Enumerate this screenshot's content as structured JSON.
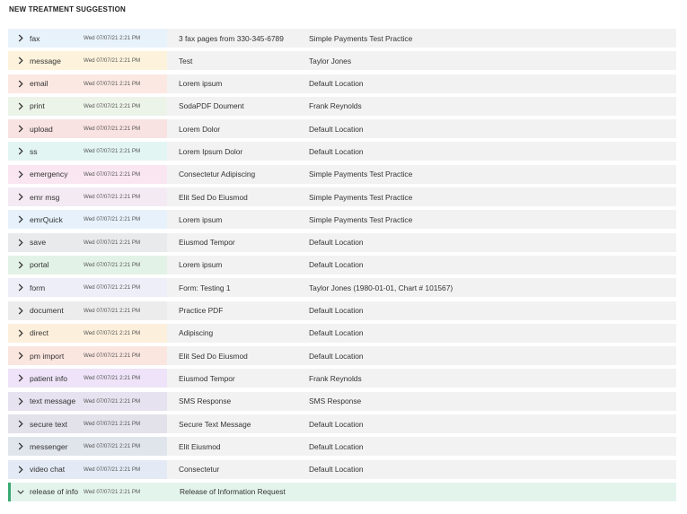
{
  "header": {
    "title": "NEW TREATMENT SUGGESTION"
  },
  "rows": [
    {
      "type": "fax",
      "date": "Wed 07/07/21 2:21 PM",
      "desc": "3 fax pages from 330-345-6789",
      "loc": "Simple Payments Test Practice",
      "color": "#3a8fd6",
      "bg": "#e8f2fb",
      "icon": "chevron-right-icon"
    },
    {
      "type": "message",
      "date": "Wed 07/07/21 2:21 PM",
      "desc": "Test",
      "loc": "Taylor Jones",
      "color": "#f0b429",
      "bg": "#fdf3dc",
      "icon": "chevron-right-icon"
    },
    {
      "type": "email",
      "date": "Wed 07/07/21 2:21 PM",
      "desc": " Lorem ipsum",
      "loc": "Default Location",
      "color": "#e06a4a",
      "bg": "#fbe8e2",
      "icon": "chevron-right-icon"
    },
    {
      "type": "print",
      "date": "Wed 07/07/21 2:21 PM",
      "desc": "SodaPDF Doument",
      "loc": "Frank Reynolds",
      "color": "#8fbc7a",
      "bg": "#ecf3e8",
      "icon": "chevron-right-icon"
    },
    {
      "type": "upload",
      "date": "Wed 07/07/21 2:21 PM",
      "desc": " Lorem Dolor",
      "loc": "Default Location",
      "color": "#d94141",
      "bg": "#f9e2e2",
      "icon": "chevron-right-icon"
    },
    {
      "type": "ss",
      "date": "Wed 07/07/21 2:21 PM",
      "desc": " Lorem Ipsum Dolor",
      "loc": "Default Location",
      "color": "#3cc4b4",
      "bg": "#e2f5f3",
      "icon": "chevron-right-icon"
    },
    {
      "type": "emergency",
      "date": "Wed 07/07/21 2:21 PM",
      "desc": " Consectetur Adipiscing",
      "loc": "Simple Payments Test Practice",
      "color": "#d6589a",
      "bg": "#f9e6f0",
      "icon": "chevron-right-icon"
    },
    {
      "type": "emr msg",
      "date": "Wed 07/07/21 2:21 PM",
      "desc": "Elit Sed Do Eiusmod",
      "loc": "Simple Payments Test Practice",
      "color": "#c78cc4",
      "bg": "#f4eaf4",
      "icon": "chevron-right-icon"
    },
    {
      "type": "emrQuick",
      "date": "Wed 07/07/21 2:21 PM",
      "desc": " Lorem ipsum",
      "loc": "Simple Payments Test Practice",
      "color": "#4a9fe0",
      "bg": "#e6f1fb",
      "icon": "chevron-right-icon"
    },
    {
      "type": "save",
      "date": "Wed 07/07/21 2:21 PM",
      "desc": "Eiusmod Tempor",
      "loc": "Default Location",
      "color": "#7a7f85",
      "bg": "#e9eaeb",
      "icon": "chevron-right-icon"
    },
    {
      "type": "portal",
      "date": "Wed 07/07/21 2:21 PM",
      "desc": " Lorem ipsum",
      "loc": "Default Location",
      "color": "#2f9a4a",
      "bg": "#e3f2e6",
      "icon": "chevron-right-icon"
    },
    {
      "type": "form",
      "date": "Wed 07/07/21 2:21 PM",
      "desc": "Form: Testing 1",
      "loc": "Taylor Jones (1980-01-01, Chart # 101567)",
      "color": "#9a9ad6",
      "bg": "#eeeef8",
      "icon": "chevron-right-icon"
    },
    {
      "type": "document",
      "date": "Wed 07/07/21 2:21 PM",
      "desc": "Practice PDF",
      "loc": "Default Location",
      "color": "#8a8a8a",
      "bg": "#ececec",
      "icon": "chevron-right-icon"
    },
    {
      "type": "direct",
      "date": "Wed 07/07/21 2:21 PM",
      "desc": "Adipiscing",
      "loc": "Default Location",
      "color": "#ef9a2a",
      "bg": "#fcefdc",
      "icon": "chevron-right-icon"
    },
    {
      "type": "pm import",
      "date": "Wed 07/07/21 2:21 PM",
      "desc": "Elit Sed Do Eiusmod",
      "loc": "Default Location",
      "color": "#e8583a",
      "bg": "#fbe5df",
      "icon": "chevron-right-icon"
    },
    {
      "type": "patient info",
      "date": "Wed 07/07/21 2:21 PM",
      "desc": "Eiusmod Tempor",
      "loc": "Frank Reynolds",
      "color": "#8a3fd0",
      "bg": "#eee3f8",
      "icon": "chevron-right-icon"
    },
    {
      "type": "text message",
      "date": "Wed 07/07/21 2:21 PM",
      "desc": "SMS Response",
      "loc": "SMS Response",
      "color": "#4a2f8a",
      "bg": "#e6e2ef",
      "icon": "chevron-right-icon"
    },
    {
      "type": "secure text",
      "date": "Wed 07/07/21 2:21 PM",
      "desc": "Secure Text Message",
      "loc": "Default Location",
      "color": "#2a1f5c",
      "bg": "#e3e1ea",
      "icon": "chevron-right-icon"
    },
    {
      "type": "messenger",
      "date": "Wed 07/07/21 2:21 PM",
      "desc": "Elit Eiusmod",
      "loc": "Default Location",
      "color": "#1f3a5c",
      "bg": "#e0e5ec",
      "icon": "chevron-right-icon"
    },
    {
      "type": "video chat",
      "date": "Wed 07/07/21 2:21 PM",
      "desc": "Consectetur",
      "loc": "Default Location",
      "color": "#2f5fa8",
      "bg": "#e3eaf5",
      "icon": "chevron-right-icon"
    },
    {
      "type": "release of info",
      "date": "Wed 07/07/21 2:21 PM",
      "desc": "Release of Information Request",
      "loc": "",
      "color": "#3aa872",
      "bg": "#e3f4ec",
      "icon": "chevron-down-icon",
      "expanded": true
    }
  ]
}
